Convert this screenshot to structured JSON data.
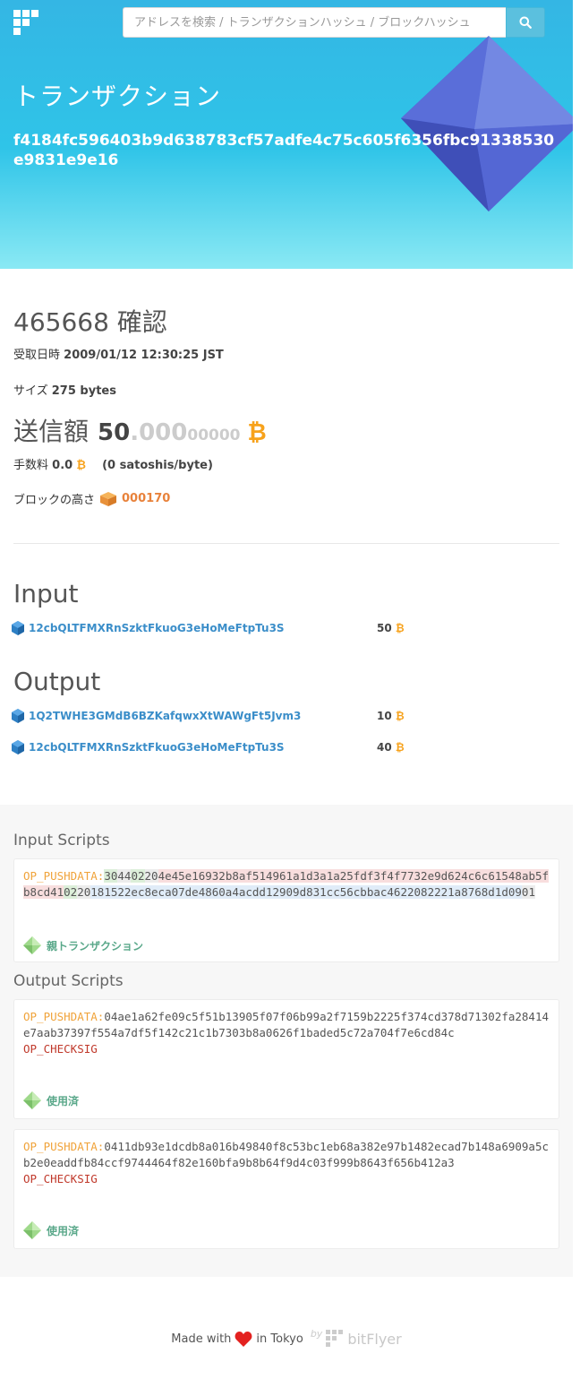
{
  "search": {
    "placeholder": "アドレスを検索 / トランザクションハッシュ / ブロックハッシュ"
  },
  "header": {
    "title": "トランザクション",
    "hash": "f4184fc596403b9d638783cf57adfe4c75c605f6356fbc91338530e9831e9e16"
  },
  "summary": {
    "confirmations": "465668 確認",
    "received_label": "受取日時",
    "received_value": "2009/01/12 12:30:25 JST",
    "size_label": "サイズ",
    "size_value": "275 bytes",
    "amount_label": "送信額",
    "amount_int": "50",
    "amount_dec1": ".000",
    "amount_dec2": "00000",
    "btc_symbol": "₿",
    "fee_label": "手数料",
    "fee_value": "0.0",
    "fee_rate": "(0 satoshis/byte)",
    "block_label": "ブロックの高さ",
    "block_height": "000170"
  },
  "inputs": {
    "title": "Input",
    "items": [
      {
        "address": "12cbQLTFMXRnSzktFkuoG3eHoMeFtpTu3S",
        "value": "50"
      }
    ]
  },
  "outputs": {
    "title": "Output",
    "items": [
      {
        "address": "1Q2TWHE3GMdB6BZKafqwxXtWAWgFt5Jvm3",
        "value": "10"
      },
      {
        "address": "12cbQLTFMXRnSzktFkuoG3eHoMeFtpTu3S",
        "value": "40"
      }
    ]
  },
  "input_scripts": {
    "title": "Input Scripts",
    "op": "OP_PUSHDATA:",
    "parts": [
      "30",
      "44",
      "02",
      "20",
      "4e45e16932b8af514961a1d3a1a25fdf3f4f7732e9d624c6c61548ab5fb8cd41",
      "02",
      "20",
      "181522ec8eca07de4860a4acdd12909d831cc56cbbac4622082221a8768d1d09",
      "01"
    ],
    "parent_link": "親トランザクション"
  },
  "output_scripts": {
    "title": "Output Scripts",
    "items": [
      {
        "op": "OP_PUSHDATA:",
        "data": "04ae1a62fe09c5f51b13905f07f06b99a2f7159b2225f374cd378d71302fa28414e7aab37397f554a7df5f142c21c1b7303b8a0626f1baded5c72a704f7e6cd84c",
        "check": "OP_CHECKSIG",
        "status": "使用済"
      },
      {
        "op": "OP_PUSHDATA:",
        "data": "0411db93e1dcdb8a016b49840f8c53bc1eb68a382e97b1482ecad7b148a6909a5cb2e0eaddfb84ccf9744464f82e160bfa9b8b64f9d4c03f999b8643f656b412a3",
        "check": "OP_CHECKSIG",
        "status": "使用済"
      }
    ]
  },
  "footer": {
    "made_with": "Made with",
    "in_tokyo": "in Tokyo",
    "by": "by",
    "brand": "bitFlyer"
  },
  "colors": {
    "header_top": "#34b6e4",
    "header_bottom": "#8ae9f4",
    "btc": "#f7a21b",
    "link": "#3b8ec9",
    "block": "#e8823b",
    "op_pushdata": "#f0a33a",
    "op_checksig": "#c0392b"
  }
}
